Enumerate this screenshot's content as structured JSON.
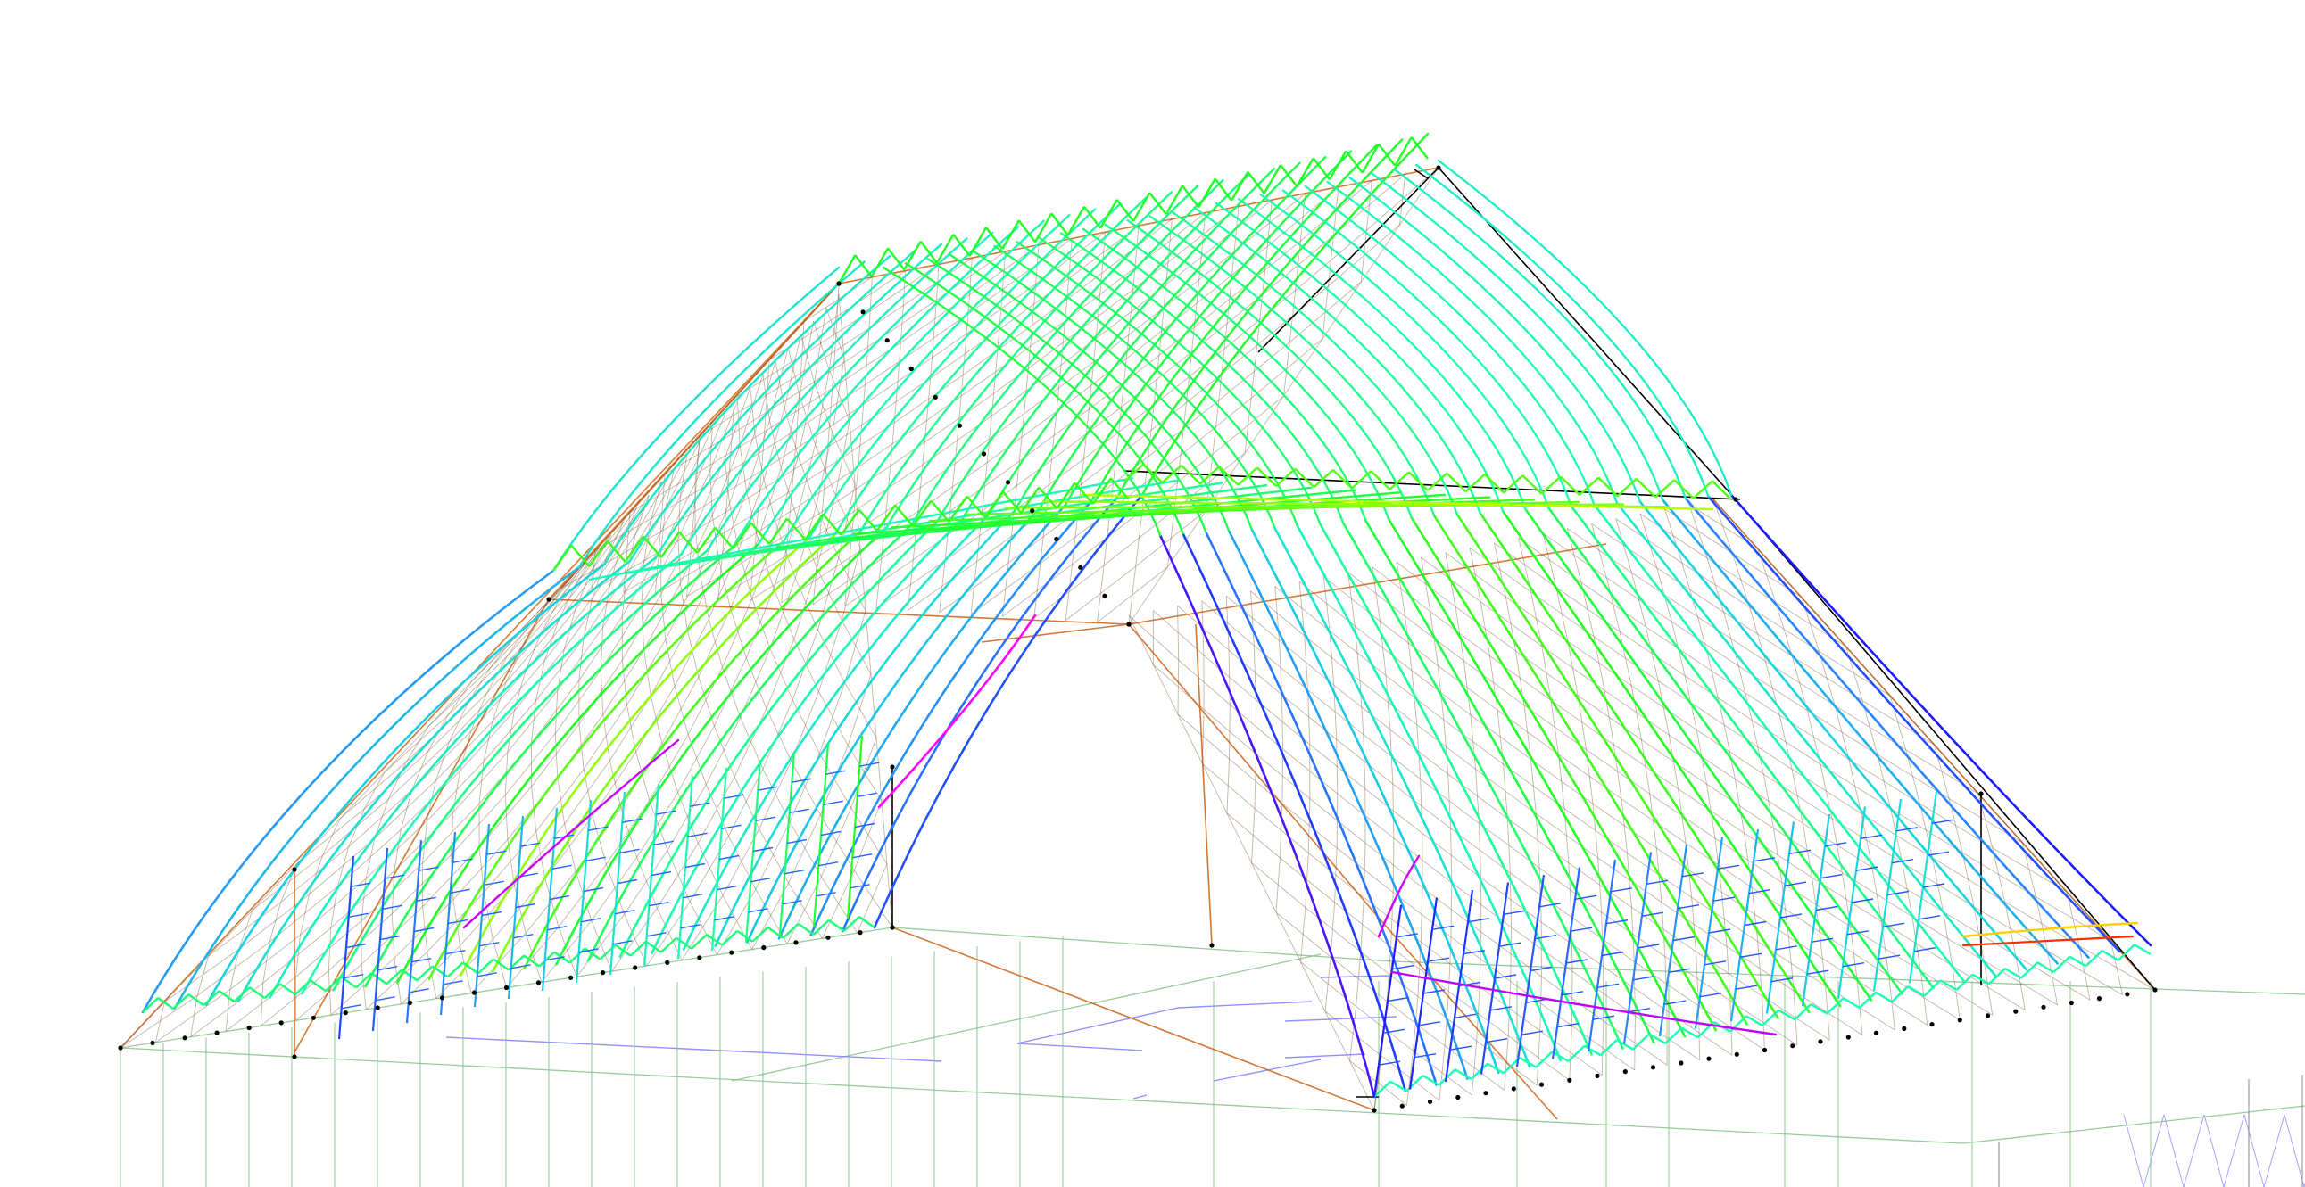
{
  "scene": {
    "kind": "structural-model-deformed-shape",
    "background": "#ffffff",
    "gradient_colors": [
      "#ff00ff",
      "#1a1aff",
      "#2a7fff",
      "#19d3e0",
      "#1cffb0",
      "#20ff20",
      "#d4ff00",
      "#ffb000",
      "#ff2000"
    ],
    "original_color": "#d2691e",
    "edge_color": "#000000",
    "grid_color": "#7fbf7f",
    "support_color": "#7f7fff",
    "node_color": "#000000"
  }
}
